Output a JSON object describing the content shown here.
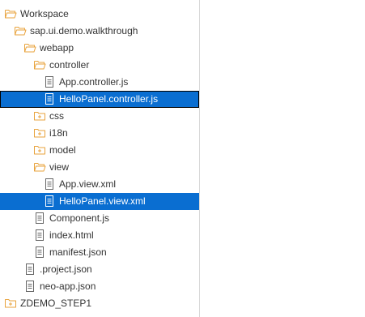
{
  "colors": {
    "folder": "#e8a33d",
    "file": "#666666",
    "selection": "#0a6ed1",
    "text": "#333333"
  },
  "tree": [
    {
      "label": "Workspace",
      "icon": "folder-open-icon",
      "level": 0,
      "selected": false,
      "focused": false
    },
    {
      "label": "sap.ui.demo.walkthrough",
      "icon": "folder-open-icon",
      "level": 1,
      "selected": false,
      "focused": false
    },
    {
      "label": "webapp",
      "icon": "folder-open-icon",
      "level": 2,
      "selected": false,
      "focused": false
    },
    {
      "label": "controller",
      "icon": "folder-open-icon",
      "level": 3,
      "selected": false,
      "focused": false
    },
    {
      "label": "App.controller.js",
      "icon": "file-icon",
      "level": 4,
      "selected": false,
      "focused": false
    },
    {
      "label": "HelloPanel.controller.js",
      "icon": "file-icon",
      "level": 4,
      "selected": true,
      "focused": true
    },
    {
      "label": "css",
      "icon": "folder-closed-icon",
      "level": 3,
      "selected": false,
      "focused": false
    },
    {
      "label": "i18n",
      "icon": "folder-closed-icon",
      "level": 3,
      "selected": false,
      "focused": false
    },
    {
      "label": "model",
      "icon": "folder-closed-icon",
      "level": 3,
      "selected": false,
      "focused": false
    },
    {
      "label": "view",
      "icon": "folder-open-icon",
      "level": 3,
      "selected": false,
      "focused": false
    },
    {
      "label": "App.view.xml",
      "icon": "file-icon",
      "level": 4,
      "selected": false,
      "focused": false
    },
    {
      "label": "HelloPanel.view.xml",
      "icon": "file-icon",
      "level": 4,
      "selected": true,
      "focused": false
    },
    {
      "label": "Component.js",
      "icon": "file-icon",
      "level": 3,
      "selected": false,
      "focused": false
    },
    {
      "label": "index.html",
      "icon": "file-icon",
      "level": 3,
      "selected": false,
      "focused": false
    },
    {
      "label": "manifest.json",
      "icon": "file-icon",
      "level": 3,
      "selected": false,
      "focused": false
    },
    {
      "label": ".project.json",
      "icon": "file-icon",
      "level": 2,
      "selected": false,
      "focused": false
    },
    {
      "label": "neo-app.json",
      "icon": "file-icon",
      "level": 2,
      "selected": false,
      "focused": false
    },
    {
      "label": "ZDEMO_STEP1",
      "icon": "folder-closed-icon",
      "level": 0,
      "selected": false,
      "focused": false
    }
  ]
}
